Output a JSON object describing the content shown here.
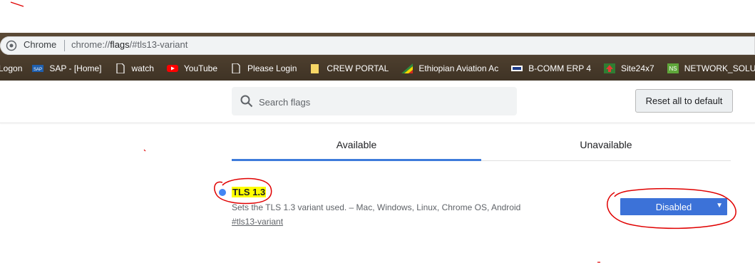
{
  "browser": {
    "site_name": "Chrome",
    "url_scheme": "chrome://",
    "url_host": "flags",
    "url_path": "/#tls13-variant",
    "bookmarks": [
      {
        "label": "Logon",
        "icon": "none"
      },
      {
        "label": "SAP - [Home]",
        "icon": "sap-icon"
      },
      {
        "label": "watch",
        "icon": "page-icon"
      },
      {
        "label": "YouTube",
        "icon": "youtube-icon"
      },
      {
        "label": "Please Login",
        "icon": "page-icon"
      },
      {
        "label": "CREW PORTAL",
        "icon": "folder-icon"
      },
      {
        "label": "Ethiopian Aviation Ac",
        "icon": "flag-icon"
      },
      {
        "label": "B-COMM ERP 4",
        "icon": "bcomm-icon"
      },
      {
        "label": "Site24x7",
        "icon": "site24x7-icon"
      },
      {
        "label": "NETWORK_SOLUTIO",
        "icon": "ns-icon"
      }
    ]
  },
  "flags_page": {
    "search": {
      "placeholder": "Search flags",
      "value": ""
    },
    "reset_label": "Reset all to default",
    "tabs": [
      {
        "label": "Available",
        "active": true
      },
      {
        "label": "Unavailable",
        "active": false
      }
    ],
    "flag": {
      "title": "TLS 1.3",
      "description": "Sets the TLS 1.3 variant used. – Mac, Windows, Linux, Chrome OS, Android",
      "anchor": "#tls13-variant",
      "selected_value": "Disabled"
    }
  },
  "colors": {
    "accent": "#3c72d8",
    "highlight": "#ffff00",
    "annotation": "#e00000",
    "frame": "#4a3c2c"
  }
}
